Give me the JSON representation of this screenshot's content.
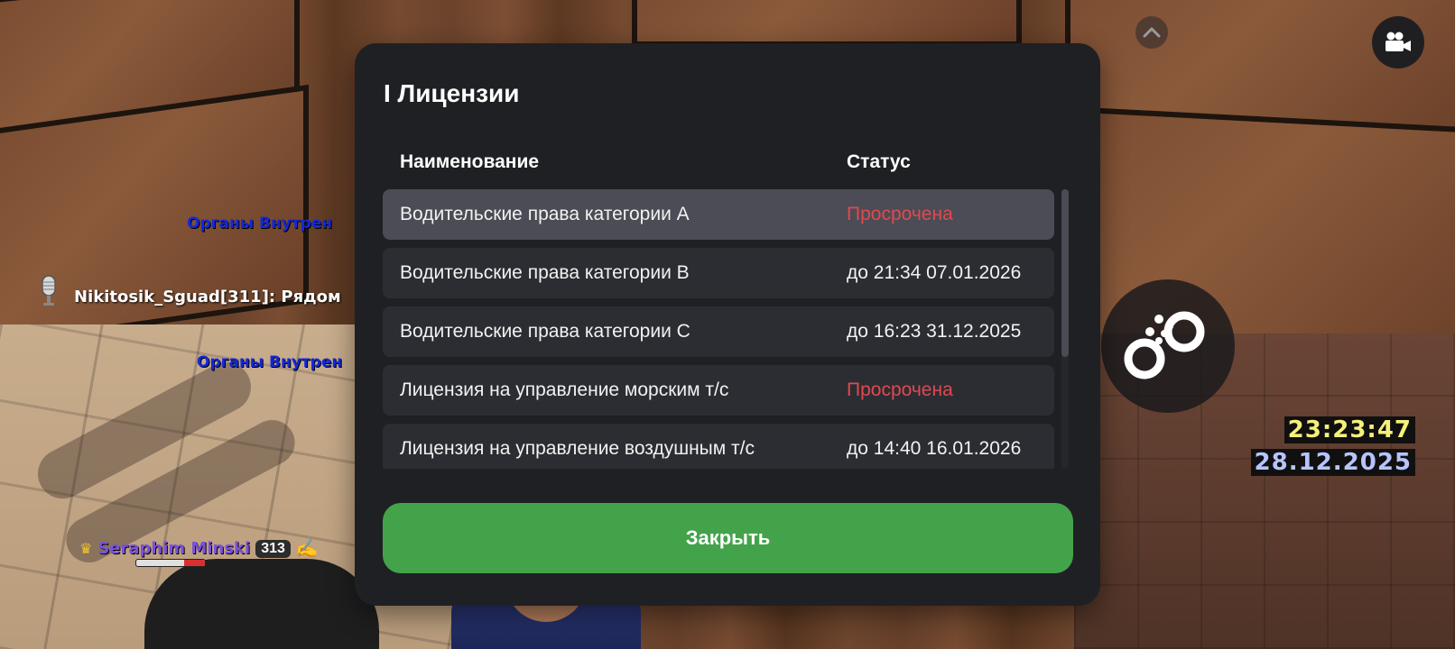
{
  "hud": {
    "faction_line_1": "Органы Внутрен",
    "faction_line_2": "Органы Внутрен",
    "speech_text": "Nikitosik_Sguad[311]: Рядом",
    "player": {
      "name": "Seraphim Minski",
      "id": "313",
      "hp_fraction": 0.3
    },
    "clock": {
      "time": "23:23:47",
      "date": "28.12.2025"
    },
    "icons": {
      "chevron": "chevron-up-icon",
      "camera": "camera-icon",
      "cuffs": "handcuffs-icon",
      "mic": "microphone-icon",
      "crown": "crown-icon",
      "writing": "writing-hand-icon"
    }
  },
  "dialog": {
    "title": "I Лицензии",
    "columns": {
      "name": "Наименование",
      "status": "Статус"
    },
    "rows": [
      {
        "name": "Водительские права категории A",
        "status": "Просрочена",
        "expired": true,
        "selected": true
      },
      {
        "name": "Водительские права категории B",
        "status": "до 21:34 07.01.2026",
        "expired": false,
        "selected": false
      },
      {
        "name": "Водительские права категории C",
        "status": "до 16:23 31.12.2025",
        "expired": false,
        "selected": false
      },
      {
        "name": "Лицензия на управление морским т/с",
        "status": "Просрочена",
        "expired": true,
        "selected": false
      },
      {
        "name": "Лицензия на управление воздушным т/с",
        "status": "до 14:40 16.01.2026",
        "expired": false,
        "selected": false
      }
    ],
    "close_label": "Закрыть"
  },
  "colors": {
    "dialog_bg": "#1f2024",
    "row_bg": "#2c2d33",
    "row_selected_bg": "#4b4c55",
    "expired": "#e0494f",
    "close_button": "#43a34a",
    "faction_text": "#1428d8",
    "clock_time": "#f5f07a",
    "clock_date": "#b8c4ff"
  }
}
